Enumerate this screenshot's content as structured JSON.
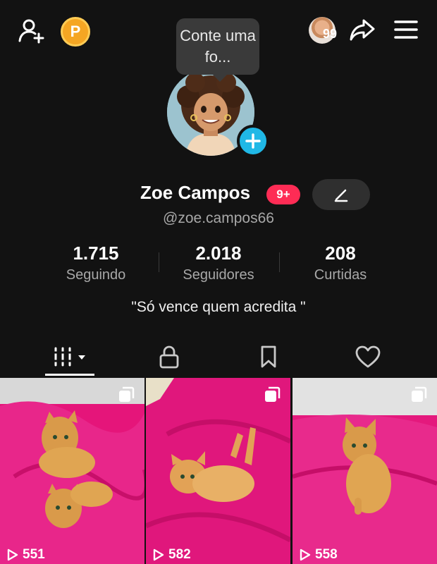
{
  "tooltip": {
    "text": "Conte uma fo..."
  },
  "topbar": {
    "friends_count": "99",
    "coin_letter": "P"
  },
  "profile": {
    "name": "Zoe Campos",
    "badge": "9+",
    "handle": "@zoe.campos66",
    "bio": "\"Só vence quem acredita \""
  },
  "stats": [
    {
      "value": "1.715",
      "label": "Seguindo"
    },
    {
      "value": "2.018",
      "label": "Seguidores"
    },
    {
      "value": "208",
      "label": "Curtidas"
    }
  ],
  "videos": [
    {
      "views": "551"
    },
    {
      "views": "582"
    },
    {
      "views": "558"
    }
  ],
  "colors": {
    "accent": "#fe2c55",
    "plus": "#20b8e6",
    "coin": "#f5a623",
    "background": "#121212"
  }
}
